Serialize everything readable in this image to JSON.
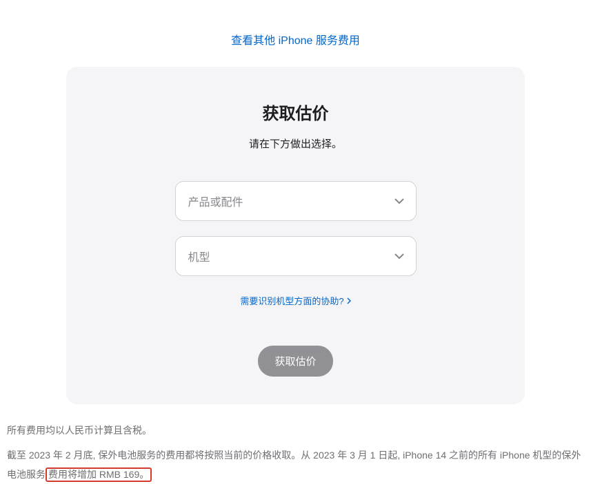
{
  "topLink": {
    "label": "查看其他 iPhone 服务费用"
  },
  "card": {
    "title": "获取估价",
    "subtitle": "请在下方做出选择。",
    "select1": {
      "placeholder": "产品或配件"
    },
    "select2": {
      "placeholder": "机型"
    },
    "helpLink": {
      "label": "需要识别机型方面的协助?"
    },
    "submitButton": {
      "label": "获取估价"
    }
  },
  "footer": {
    "line1": "所有费用均以人民币计算且含税。",
    "line2_part1": "截至 2023 年 2 月底, 保外电池服务的费用都将按照当前的价格收取。从 2023 年 3 月 1 日起, iPhone 14 之前的所有 iPhone 机型的保外电池服务",
    "line2_part2": "费用将增加 RMB 169。"
  }
}
